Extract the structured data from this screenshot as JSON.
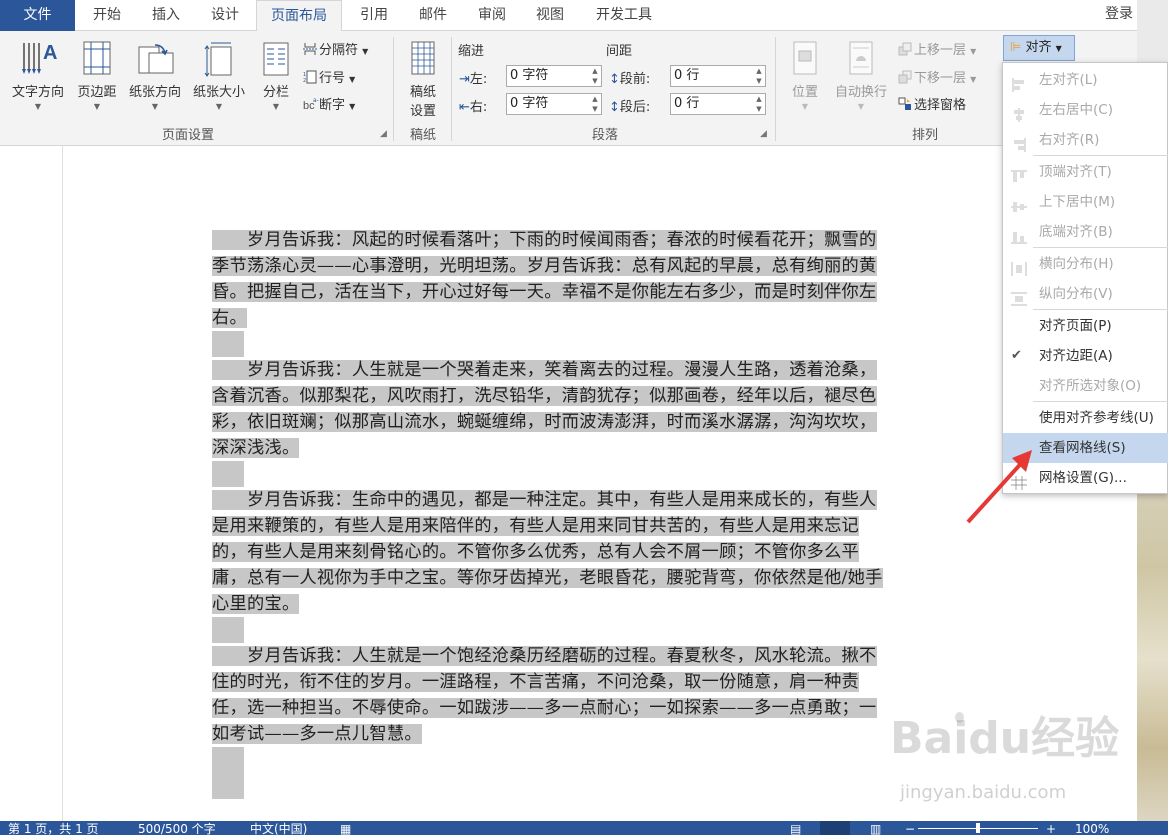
{
  "tabs": {
    "file": "文件",
    "home": "开始",
    "insert": "插入",
    "design": "设计",
    "layout": "页面布局",
    "references": "引用",
    "mailings": "邮件",
    "review": "审阅",
    "view": "视图",
    "developer": "开发工具"
  },
  "login": "登录",
  "ribbon": {
    "page_setup": {
      "text_direction": "文字方向",
      "margins": "页边距",
      "orientation": "纸张方向",
      "size": "纸张大小",
      "columns": "分栏",
      "breaks": "分隔符",
      "line_numbers": "行号",
      "hyphenation": "断字",
      "label": "页面设置"
    },
    "draft": {
      "btn": "稿纸",
      "btn2": "设置",
      "label": "稿纸"
    },
    "paragraph": {
      "indent_title": "缩进",
      "spacing_title": "间距",
      "left_label": "左:",
      "left_value": "0 字符",
      "right_label": "右:",
      "right_value": "0 字符",
      "before_label": "段前:",
      "before_value": "0 行",
      "after_label": "段后:",
      "after_value": "0 行",
      "label": "段落"
    },
    "arrange": {
      "position": "位置",
      "wrap": "自动换行",
      "bring_forward": "上移一层",
      "send_backward": "下移一层",
      "selection_pane": "选择窗格",
      "align": "对齐",
      "label": "排列"
    }
  },
  "align_menu": {
    "items": [
      {
        "label": "左对齐(L)",
        "enabled": false,
        "icon": "align-left-icon"
      },
      {
        "label": "左右居中(C)",
        "enabled": false,
        "icon": "align-center-icon"
      },
      {
        "label": "右对齐(R)",
        "enabled": false,
        "icon": "align-right-icon"
      },
      {
        "label": "顶端对齐(T)",
        "enabled": false,
        "icon": "align-top-icon"
      },
      {
        "label": "上下居中(M)",
        "enabled": false,
        "icon": "align-middle-icon"
      },
      {
        "label": "底端对齐(B)",
        "enabled": false,
        "icon": "align-bottom-icon"
      },
      {
        "label": "横向分布(H)",
        "enabled": false,
        "icon": "distribute-horizontal-icon"
      },
      {
        "label": "纵向分布(V)",
        "enabled": false,
        "icon": "distribute-vertical-icon"
      },
      {
        "label": "对齐页面(P)",
        "enabled": true,
        "icon": ""
      },
      {
        "label": "对齐边距(A)",
        "enabled": true,
        "icon": "checkmark-icon"
      },
      {
        "label": "对齐所选对象(O)",
        "enabled": false,
        "icon": ""
      },
      {
        "label": "使用对齐参考线(U)",
        "enabled": true,
        "icon": ""
      },
      {
        "label": "查看网格线(S)",
        "enabled": true,
        "icon": ""
      },
      {
        "label": "网格设置(G)...",
        "enabled": true,
        "icon": "grid-settings-icon"
      }
    ]
  },
  "document": {
    "paragraphs": [
      "　　岁月告诉我：风起的时候看落叶；下雨的时候闻雨香；春浓的时候看花开；飘雪的季节荡涤心灵——心事澄明，光明坦荡。岁月告诉我：总有风起的早晨，总有绚丽的黄昏。把握自己，活在当下，开心过好每一天。幸福不是你能左右多少，而是时刻伴你左右。",
      "　　岁月告诉我：人生就是一个哭着走来，笑着离去的过程。漫漫人生路，透着沧桑，含着沉香。似那梨花，风吹雨打，洗尽铅华，清韵犹存；似那画卷，经年以后，褪尽色彩，依旧斑斓；似那高山流水，蜿蜒缠绵，时而波涛澎湃，时而溪水潺潺，沟沟坎坎，深深浅浅。",
      "　　岁月告诉我：生命中的遇见，都是一种注定。其中，有些人是用来成长的，有些人是用来鞭策的，有些人是用来陪伴的，有些人是用来同甘共苦的，有些人是用来忘记的，有些人是用来刻骨铭心的。不管你多么优秀，总有人会不屑一顾；不管你多么平庸，总有一人视你为手中之宝。等你牙齿掉光，老眼昏花，腰驼背弯，你依然是他/她手心里的宝。",
      "　　岁月告诉我：人生就是一个饱经沧桑历经磨砺的过程。春夏秋冬，风水轮流。揪不住的时光，衔不住的岁月。一涯路程，不言苦痛，不问沧桑，取一份随意，肩一种责任，选一种担当。不辱使命。一如跋涉——多一点耐心；一如探索——多一点勇敢；一如考试——多一点儿智慧。"
    ]
  },
  "status": {
    "page": "第 1 页，共 1 页",
    "words": "500/500 个字",
    "language": "中文(中国)",
    "zoom": "100%"
  },
  "watermark": {
    "brand": "Baidu经验",
    "url": "jingyan.baidu.com"
  },
  "colors": {
    "accent": "#2b579a",
    "highlight": "#c5d7ee",
    "arrow": "#e53935"
  }
}
